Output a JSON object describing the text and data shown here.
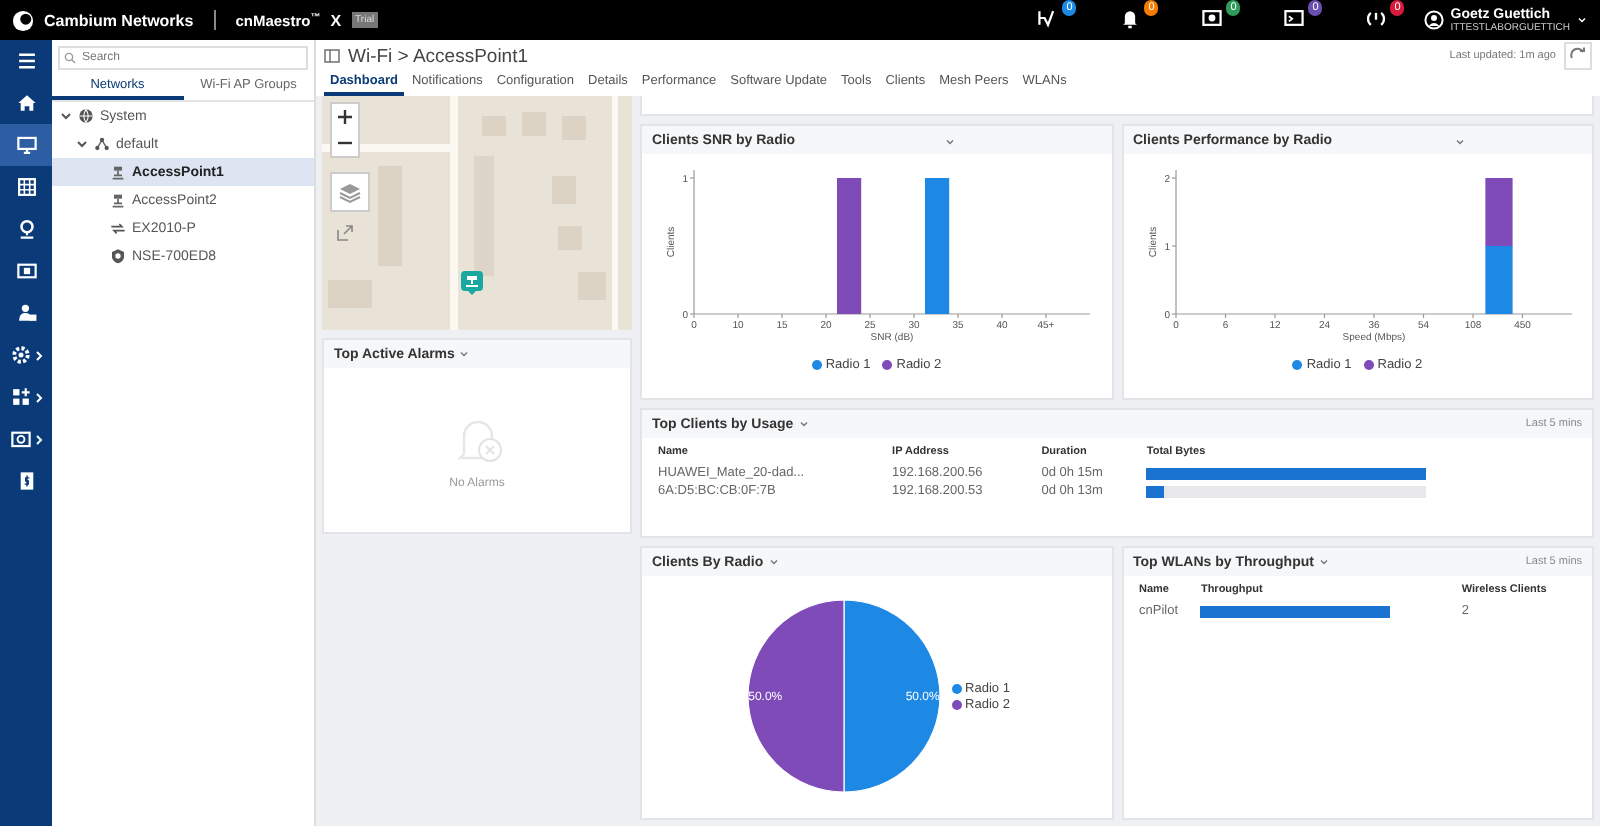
{
  "header": {
    "brand": "Cambium Networks",
    "product": "cnMaestro",
    "trademark": "™",
    "edition": "X",
    "badge": "Trial",
    "alerts": [
      {
        "count": "0",
        "color": "#1e88e5"
      },
      {
        "count": "0",
        "color": "#f57c00"
      },
      {
        "count": "0",
        "color": "#2e9d5b"
      },
      {
        "count": "0",
        "color": "#6a4fb0"
      },
      {
        "count": "0",
        "color": "#d81b3c"
      }
    ],
    "user": {
      "name": "Goetz Guettich",
      "account": "ITTESTLABORGUETTICH"
    }
  },
  "rail": [
    {
      "selected": false,
      "expandable": false
    },
    {
      "selected": false,
      "expandable": false
    },
    {
      "selected": true,
      "expandable": false
    },
    {
      "selected": false,
      "expandable": false
    },
    {
      "selected": false,
      "expandable": false
    },
    {
      "selected": false,
      "expandable": false
    },
    {
      "selected": false,
      "expandable": false
    },
    {
      "selected": false,
      "expandable": true
    },
    {
      "selected": false,
      "expandable": true
    },
    {
      "selected": false,
      "expandable": true
    },
    {
      "selected": false,
      "expandable": false
    }
  ],
  "navigator": {
    "search": {
      "placeholder": "Search"
    },
    "tabs": [
      {
        "label": "Networks",
        "selected": true
      },
      {
        "label": "Wi-Fi AP Groups",
        "selected": false
      }
    ],
    "tree": [
      {
        "label": "System",
        "kind": "group",
        "expanded": true,
        "selected": false,
        "children": [
          {
            "label": "default",
            "kind": "network",
            "expanded": true,
            "selected": false,
            "children": [
              {
                "label": "AccessPoint1",
                "kind": "ap",
                "selected": true
              },
              {
                "label": "AccessPoint2",
                "kind": "ap",
                "selected": false
              },
              {
                "label": "EX2010-P",
                "kind": "switch",
                "selected": false
              },
              {
                "label": "NSE-700ED8",
                "kind": "gateway",
                "selected": false
              }
            ]
          }
        ]
      }
    ]
  },
  "page": {
    "title": "Wi-Fi > AccessPoint1",
    "tabs": [
      {
        "label": "Dashboard",
        "selected": true
      },
      {
        "label": "Notifications",
        "selected": false
      },
      {
        "label": "Configuration",
        "selected": false
      },
      {
        "label": "Details",
        "selected": false
      },
      {
        "label": "Performance",
        "selected": false
      },
      {
        "label": "Software Update",
        "selected": false
      },
      {
        "label": "Tools",
        "selected": false
      },
      {
        "label": "Clients",
        "selected": false
      },
      {
        "label": "Mesh Peers",
        "selected": false
      },
      {
        "label": "WLANs",
        "selected": false
      }
    ],
    "last_updated": "Last updated: 1m ago"
  },
  "alarms": {
    "title": "Top Active Alarms",
    "empty": "No Alarms"
  },
  "snr": {
    "title": "Clients SNR by Radio",
    "chart_data": {
      "type": "bar",
      "xlabel": "SNR (dB)",
      "ylabel": "Clients",
      "categories": [
        "0",
        "10",
        "15",
        "20",
        "25",
        "30",
        "35",
        "40",
        "45+"
      ],
      "stacked": true,
      "ylim": [
        0,
        1
      ],
      "yticks": [
        0,
        1
      ],
      "series": [
        {
          "name": "Radio 1",
          "color": "#1e88e5",
          "values": [
            0,
            0,
            0,
            0,
            0,
            1,
            0,
            0,
            0
          ]
        },
        {
          "name": "Radio 2",
          "color": "#7e4bb8",
          "values": [
            0,
            0,
            0,
            1,
            0,
            0,
            0,
            0,
            0
          ]
        }
      ]
    }
  },
  "performance": {
    "title": "Clients Performance by Radio",
    "chart_data": {
      "type": "bar",
      "xlabel": "Speed (Mbps)",
      "ylabel": "Clients",
      "categories": [
        "0",
        "6",
        "12",
        "24",
        "36",
        "54",
        "108",
        "450"
      ],
      "stacked": true,
      "ylim": [
        0,
        2
      ],
      "yticks": [
        0,
        1,
        2
      ],
      "series": [
        {
          "name": "Radio 1",
          "color": "#1e88e5",
          "values": [
            0,
            0,
            0,
            0,
            0,
            0,
            1,
            0
          ]
        },
        {
          "name": "Radio 2",
          "color": "#7e4bb8",
          "values": [
            0,
            0,
            0,
            0,
            0,
            0,
            1,
            0
          ]
        }
      ]
    }
  },
  "top_clients": {
    "title": "Top Clients by Usage",
    "period": "Last 5 mins",
    "columns": [
      "Name",
      "IP Address",
      "Duration",
      "Total Bytes"
    ],
    "rows": [
      {
        "name": "HUAWEI_Mate_20-dad...",
        "ip": "192.168.200.56",
        "duration": "0d 0h 15m",
        "level": 1
      },
      {
        "name": "6A:D5:BC:CB:0F:7B",
        "ip": "192.168.200.53",
        "duration": "0d 0h 13m",
        "level": 0.06
      }
    ]
  },
  "clients_by_radio": {
    "title": "Clients By Radio",
    "chart_data": {
      "type": "pie",
      "categories": [
        "Radio 1",
        "Radio 2"
      ],
      "values": [
        50,
        50
      ],
      "colors": [
        "#1e88e5",
        "#7e4bb8"
      ],
      "value_labels": [
        "50.0%",
        "50.0%"
      ]
    }
  },
  "top_wlans": {
    "title": "Top WLANs by Throughput",
    "period": "Last 5 mins",
    "columns": [
      "Name",
      "Throughput",
      "Wireless Clients"
    ],
    "rows": [
      {
        "name": "cnPilot",
        "level": 1,
        "clients": "2"
      }
    ]
  }
}
